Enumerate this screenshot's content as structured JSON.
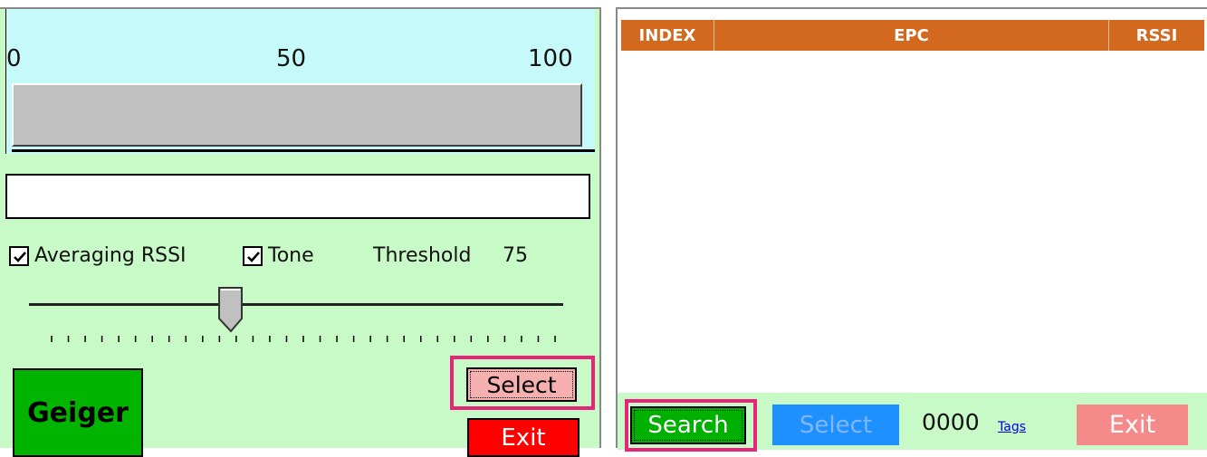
{
  "left_panel": {
    "scale": {
      "min_label": "0",
      "mid_label": "50",
      "max_label": "100"
    },
    "meter": {
      "level_percent": 0
    },
    "epc_field": {
      "value": ""
    },
    "averaging_rssi": {
      "label": "Averaging RSSI",
      "checked": true
    },
    "tone": {
      "label": "Tone",
      "checked": true
    },
    "threshold": {
      "label": "Threshold",
      "value": "75"
    },
    "slider": {
      "value_fraction": 0.37,
      "tick_count": 31
    },
    "buttons": {
      "geiger": "Geiger",
      "select": "Select",
      "exit": "Exit"
    }
  },
  "right_panel": {
    "table": {
      "columns": [
        "INDEX",
        "EPC",
        "RSSI"
      ],
      "rows": []
    },
    "buttons": {
      "search": "Search",
      "select": "Select",
      "exit": "Exit"
    },
    "tag_count": "0000",
    "tags_link": "Tags"
  },
  "colors": {
    "highlight": "#e8237a",
    "header": "#d2691e",
    "panel_bg": "#c8fac8",
    "scale_bg": "#c6fafa",
    "geiger": "#00b400",
    "exit_left": "#ff0000",
    "exit_right": "#f48a8a",
    "search": "#00b000",
    "select_right": "#1e90ff"
  }
}
